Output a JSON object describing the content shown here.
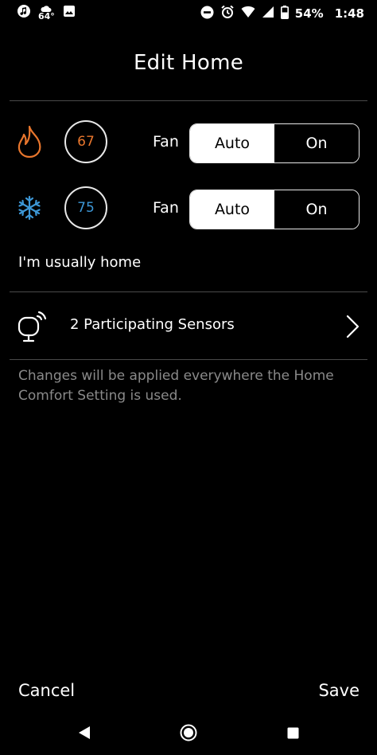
{
  "status_bar": {
    "temperature": "64°",
    "battery": "54%",
    "time": "1:48"
  },
  "header": {
    "title": "Edit Home"
  },
  "heat": {
    "setpoint": "67",
    "fan_label": "Fan",
    "options": [
      "Auto",
      "On"
    ],
    "selected": "Auto",
    "color": "#e8762d"
  },
  "cool": {
    "setpoint": "75",
    "fan_label": "Fan",
    "options": [
      "Auto",
      "On"
    ],
    "selected": "Auto",
    "color": "#3d97d6"
  },
  "presence_text": "I'm usually home",
  "sensors": {
    "label": "2 Participating Sensors"
  },
  "note": "Changes will be applied everywhere the Home Comfort Setting is used.",
  "footer": {
    "cancel": "Cancel",
    "save": "Save"
  }
}
